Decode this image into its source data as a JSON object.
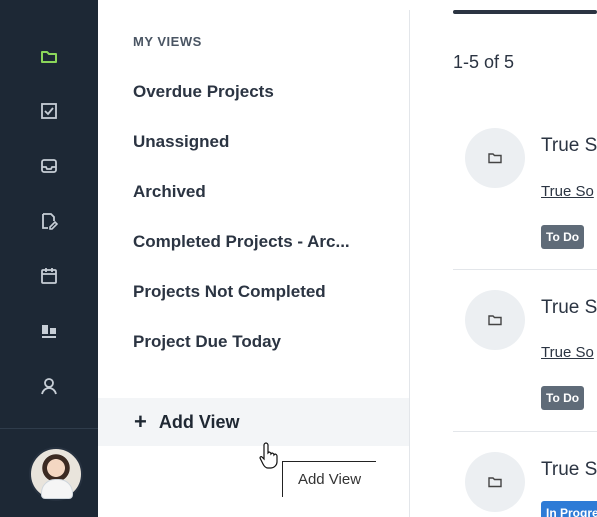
{
  "sidebar_views": {
    "header": "MY VIEWS",
    "items": [
      {
        "label": "Overdue Projects"
      },
      {
        "label": "Unassigned"
      },
      {
        "label": "Archived"
      },
      {
        "label": "Completed Projects - Arc..."
      },
      {
        "label": "Projects Not Completed"
      },
      {
        "label": "Project Due Today"
      }
    ],
    "add_view_label": "Add View",
    "add_view_icon": "plus-icon",
    "tooltip": "Add View"
  },
  "rail": {
    "icons": [
      "folder-icon",
      "checkbox-icon",
      "inbox-icon",
      "document-edit-icon",
      "calendar-icon",
      "board-icon",
      "user-icon"
    ],
    "active_icon": "folder-icon",
    "active_color": "#8bd65a"
  },
  "content": {
    "count": "1-5 of 5",
    "cards": [
      {
        "title": "True So",
        "subtitle": "True So",
        "status": "To Do",
        "status_color": "#5f6b78"
      },
      {
        "title": "True So",
        "subtitle": "True So",
        "status": "To Do",
        "status_color": "#5f6b78"
      },
      {
        "title": "True So",
        "subtitle": "",
        "status": "In Progre",
        "status_color": "#2e7bd6"
      }
    ]
  }
}
